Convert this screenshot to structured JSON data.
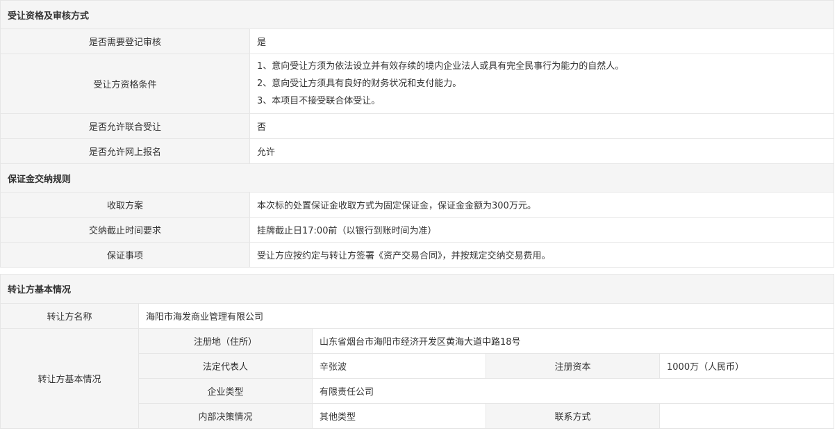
{
  "section1": {
    "title": "受让资格及审核方式",
    "rows": {
      "need_register_review": {
        "label": "是否需要登记审核",
        "value": "是"
      },
      "qualification": {
        "label": "受让方资格条件",
        "lines": [
          "1、意向受让方须为依法设立并有效存续的境内企业法人或具有完全民事行为能力的自然人。",
          "2、意向受让方须具有良好的财务状况和支付能力。",
          "3、本项目不接受联合体受让。"
        ]
      },
      "allow_joint": {
        "label": "是否允许联合受让",
        "value": "否"
      },
      "allow_online": {
        "label": "是否允许网上报名",
        "value": "允许"
      }
    }
  },
  "section2": {
    "title": "保证金交纳规则",
    "rows": {
      "collection_plan": {
        "label": "收取方案",
        "value": "本次标的处置保证金收取方式为固定保证金，保证金金额为300万元。"
      },
      "deadline": {
        "label": "交纳截止时间要求",
        "value": "挂牌截止日17:00前（以银行到账时间为准）"
      },
      "notes": {
        "label": "保证事项",
        "value": "受让方应按约定与转让方签署《资产交易合同》，并按规定交纳交易费用。"
      }
    }
  },
  "section3": {
    "title": "转让方基本情况",
    "name": {
      "label": "转让方名称",
      "value": "海阳市海发商业管理有限公司"
    },
    "basic_label": "转让方基本情况",
    "registered_address": {
      "label": "注册地（住所）",
      "value": "山东省烟台市海阳市经济开发区黄海大道中路18号"
    },
    "legal_rep": {
      "label": "法定代表人",
      "value": "辛张波"
    },
    "registered_capital": {
      "label": "注册资本",
      "value": "1000万（人民币）"
    },
    "company_type": {
      "label": "企业类型",
      "value": "有限责任公司"
    },
    "internal_decision": {
      "label": "内部决策情况",
      "value": "其他类型"
    },
    "contact": {
      "label": "联系方式",
      "value": ""
    }
  }
}
